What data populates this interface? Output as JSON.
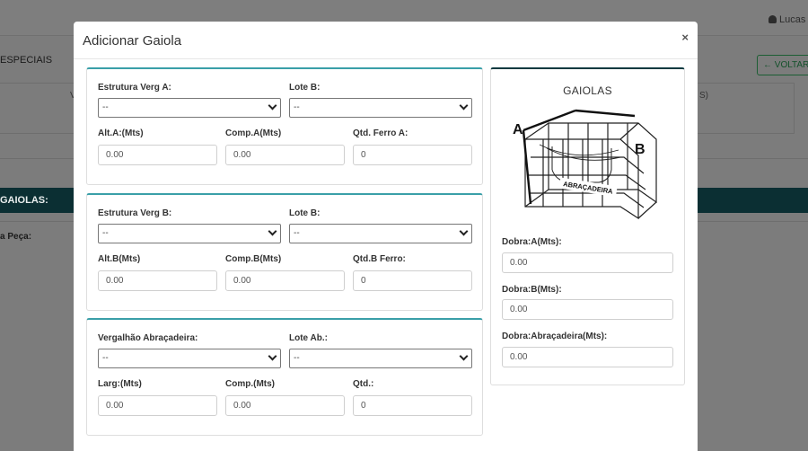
{
  "background": {
    "user_name": "Lucas C.",
    "page_title": "ESPECIAIS",
    "back_button": "VOLTAR A",
    "card_text_left": "V",
    "card_text_right": "S)",
    "gaiolas_bar": "GAIOLAS:",
    "peca_label": "a Peça:"
  },
  "modal": {
    "title": "Adicionar Gaiola",
    "close": "×"
  },
  "section_a": {
    "estrutura_label": "Estrutura Verg A:",
    "estrutura_value": "--",
    "lote_label": "Lote B:",
    "lote_value": "--",
    "alt_label": "Alt.A:(Mts)",
    "alt_value": "0.00",
    "comp_label": "Comp.A(Mts)",
    "comp_value": "0.00",
    "qtd_label": "Qtd. Ferro A:",
    "qtd_value": "0"
  },
  "section_b": {
    "estrutura_label": "Estrutura Verg B:",
    "estrutura_value": "--",
    "lote_label": "Lote B:",
    "lote_value": "--",
    "alt_label": "Alt.B(Mts)",
    "alt_value": "0.00",
    "comp_label": "Comp.B(Mts)",
    "comp_value": "0.00",
    "qtd_label": "Qtd.B Ferro:",
    "qtd_value": "0"
  },
  "section_ab": {
    "estrutura_label": "Vergalhão Abraçadeira:",
    "estrutura_value": "--",
    "lote_label": "Lote Ab.:",
    "lote_value": "--",
    "alt_label": "Larg:(Mts)",
    "alt_value": "0.00",
    "comp_label": "Comp.(Mts)",
    "comp_value": "0.00",
    "qtd_label": "Qtd.:",
    "qtd_value": "0"
  },
  "side": {
    "title": "GAIOLAS",
    "diagram_labels": {
      "a": "A",
      "b": "B",
      "abracadeira": "ABRAÇADEIRA"
    },
    "dobra_a_label": "Dobra:A(Mts):",
    "dobra_a_value": "0.00",
    "dobra_b_label": "Dobra:B(Mts):",
    "dobra_b_value": "0.00",
    "dobra_ab_label": "Dobra:Abraçadeira(Mts):",
    "dobra_ab_value": "0.00"
  }
}
